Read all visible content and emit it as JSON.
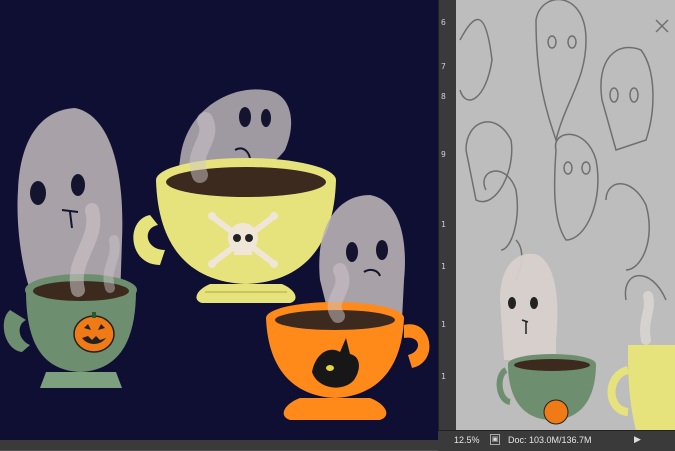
{
  "window": {
    "title": ""
  },
  "ruler": {
    "ticks": [
      "6",
      "7",
      "8",
      "9",
      "1",
      "1",
      "1",
      "1"
    ]
  },
  "status_bar": {
    "zoom": "12.5%",
    "doc_info": "Doc: 103.0M/136.7M",
    "arrow": "▶"
  },
  "colors": {
    "canvas_bg": "#0f0f33",
    "cup_green": "#6e8f6f",
    "cup_yellow": "#e7e37c",
    "cup_orange": "#ff8a1a",
    "ghost": "#bdb4b7",
    "sketch_paper": "#bdbdbd"
  },
  "icons": {
    "skull": "skull-crossbones-icon",
    "pumpkin": "jack-o-lantern-icon",
    "cat": "black-cat-icon"
  }
}
